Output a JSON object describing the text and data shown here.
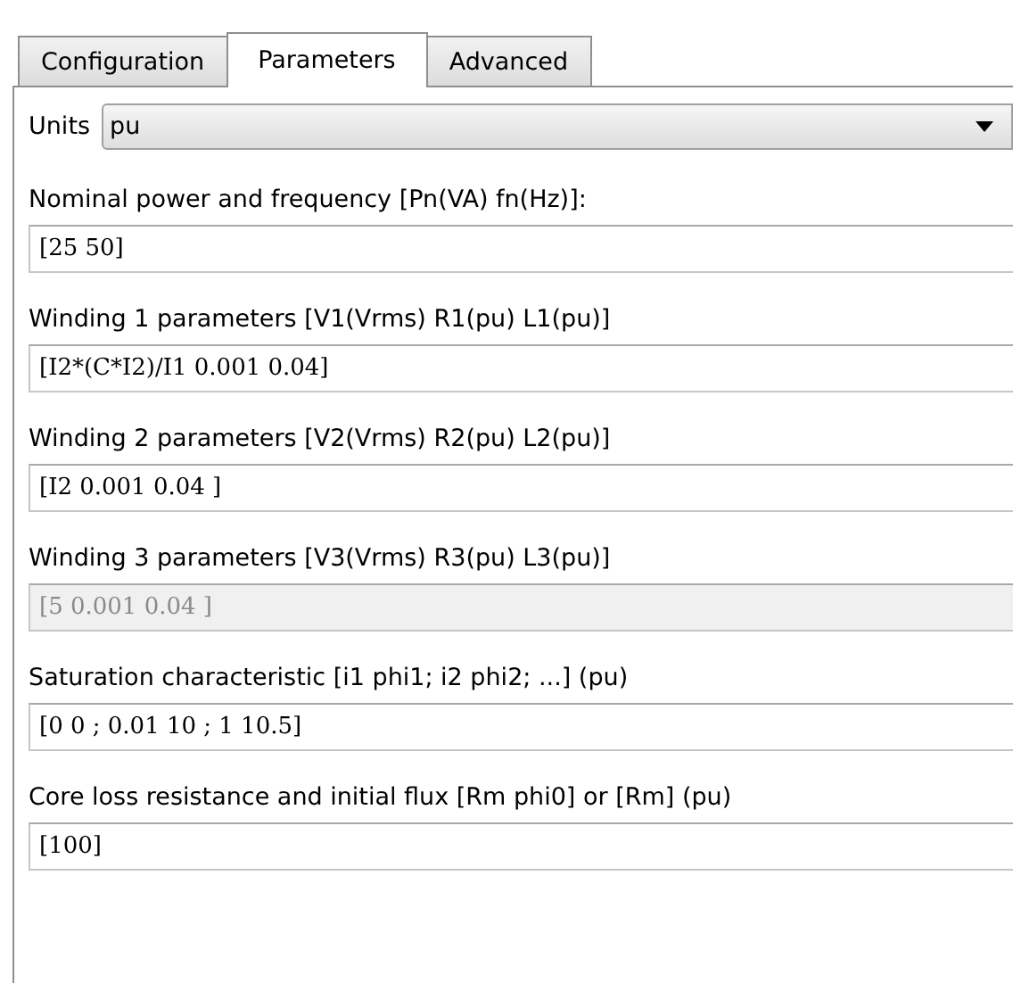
{
  "tabs": [
    {
      "label": "Configuration",
      "selected": false
    },
    {
      "label": "Parameters",
      "selected": true
    },
    {
      "label": "Advanced",
      "selected": false
    }
  ],
  "units": {
    "label": "Units",
    "value": "pu"
  },
  "parameters": [
    {
      "label": "Nominal power and frequency [Pn(VA) fn(Hz)]:",
      "value": "[25 50]",
      "disabled": false
    },
    {
      "label": "Winding 1 parameters [V1(Vrms) R1(pu) L1(pu)]",
      "value": "[I2*(C*I2)/I1 0.001 0.04]",
      "disabled": false
    },
    {
      "label": "Winding 2 parameters [V2(Vrms) R2(pu) L2(pu)]",
      "value": "[I2 0.001 0.04 ]",
      "disabled": false
    },
    {
      "label": "Winding 3 parameters [V3(Vrms) R3(pu) L3(pu)]",
      "value": "[5 0.001 0.04 ]",
      "disabled": true
    },
    {
      "label": "Saturation characteristic [i1 phi1; i2 phi2; ...] (pu)",
      "value": "[0 0 ; 0.01 10 ; 1 10.5]",
      "disabled": false
    },
    {
      "label": "Core loss resistance and initial flux [Rm phi0] or [Rm] (pu)",
      "value": "[100]",
      "disabled": false
    }
  ]
}
